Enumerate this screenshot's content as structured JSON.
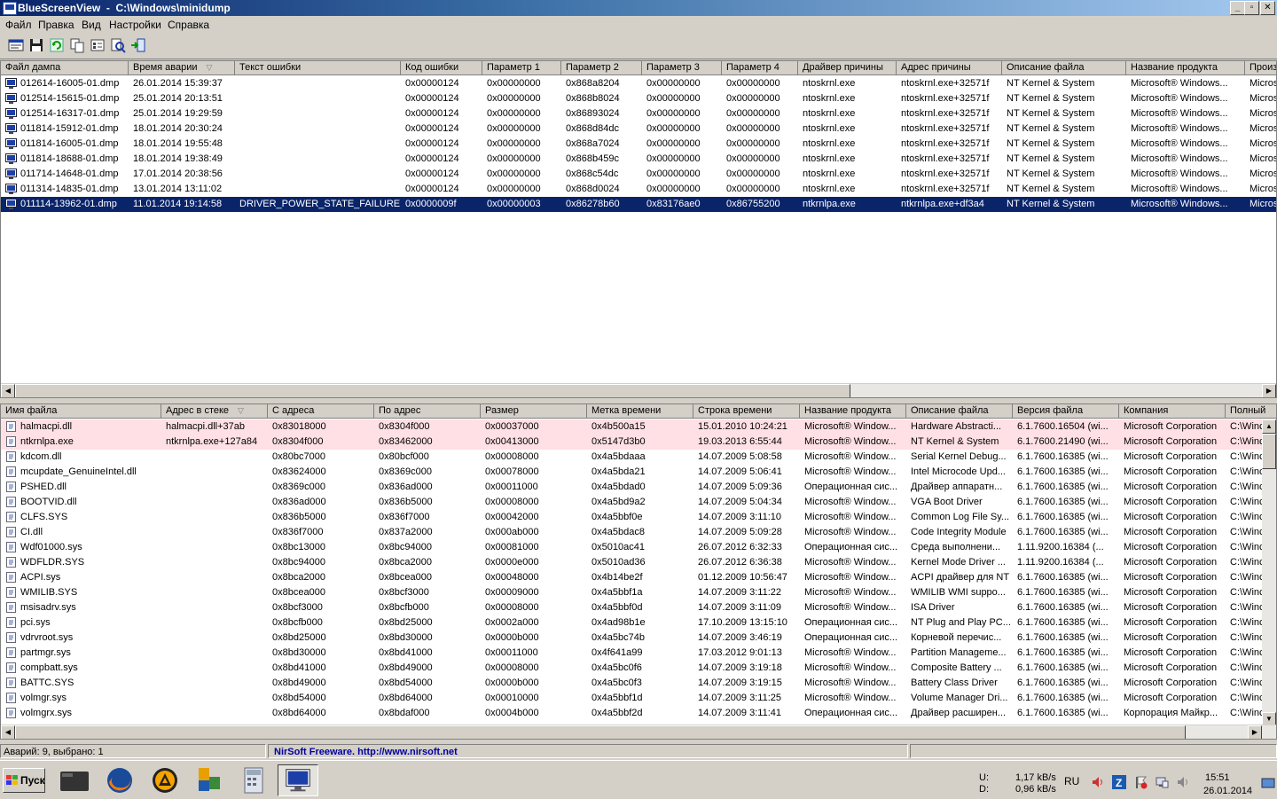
{
  "window": {
    "title": "BlueScreenView  -  C:\\Windows\\minidump"
  },
  "menu": [
    "Файл",
    "Правка",
    "Вид",
    "Настройки",
    "Справка"
  ],
  "toolbar_icons": [
    "properties-icon",
    "save-icon",
    "refresh-icon",
    "copy-icon",
    "options-icon",
    "find-icon",
    "exit-icon"
  ],
  "crashes": {
    "columns": [
      "Файл дампа",
      "Время аварии",
      "Текст ошибки",
      "Код ошибки",
      "Параметр 1",
      "Параметр 2",
      "Параметр 3",
      "Параметр 4",
      "Драйвер причины",
      "Адрес причины",
      "Описание файла",
      "Название продукта",
      "Произв"
    ],
    "sorted_column": 1,
    "rows": [
      [
        "012614-16005-01.dmp",
        "26.01.2014 15:39:37",
        "",
        "0x00000124",
        "0x00000000",
        "0x868a8204",
        "0x00000000",
        "0x00000000",
        "ntoskrnl.exe",
        "ntoskrnl.exe+32571f",
        "NT Kernel & System",
        "Microsoft® Windows...",
        "Micros"
      ],
      [
        "012514-15615-01.dmp",
        "25.01.2014 20:13:51",
        "",
        "0x00000124",
        "0x00000000",
        "0x868b8024",
        "0x00000000",
        "0x00000000",
        "ntoskrnl.exe",
        "ntoskrnl.exe+32571f",
        "NT Kernel & System",
        "Microsoft® Windows...",
        "Micros"
      ],
      [
        "012514-16317-01.dmp",
        "25.01.2014 19:29:59",
        "",
        "0x00000124",
        "0x00000000",
        "0x86893024",
        "0x00000000",
        "0x00000000",
        "ntoskrnl.exe",
        "ntoskrnl.exe+32571f",
        "NT Kernel & System",
        "Microsoft® Windows...",
        "Micros"
      ],
      [
        "011814-15912-01.dmp",
        "18.01.2014 20:30:24",
        "",
        "0x00000124",
        "0x00000000",
        "0x868d84dc",
        "0x00000000",
        "0x00000000",
        "ntoskrnl.exe",
        "ntoskrnl.exe+32571f",
        "NT Kernel & System",
        "Microsoft® Windows...",
        "Micros"
      ],
      [
        "011814-16005-01.dmp",
        "18.01.2014 19:55:48",
        "",
        "0x00000124",
        "0x00000000",
        "0x868a7024",
        "0x00000000",
        "0x00000000",
        "ntoskrnl.exe",
        "ntoskrnl.exe+32571f",
        "NT Kernel & System",
        "Microsoft® Windows...",
        "Micros"
      ],
      [
        "011814-18688-01.dmp",
        "18.01.2014 19:38:49",
        "",
        "0x00000124",
        "0x00000000",
        "0x868b459c",
        "0x00000000",
        "0x00000000",
        "ntoskrnl.exe",
        "ntoskrnl.exe+32571f",
        "NT Kernel & System",
        "Microsoft® Windows...",
        "Micros"
      ],
      [
        "011714-14648-01.dmp",
        "17.01.2014 20:38:56",
        "",
        "0x00000124",
        "0x00000000",
        "0x868c54dc",
        "0x00000000",
        "0x00000000",
        "ntoskrnl.exe",
        "ntoskrnl.exe+32571f",
        "NT Kernel & System",
        "Microsoft® Windows...",
        "Micros"
      ],
      [
        "011314-14835-01.dmp",
        "13.01.2014 13:11:02",
        "",
        "0x00000124",
        "0x00000000",
        "0x868d0024",
        "0x00000000",
        "0x00000000",
        "ntoskrnl.exe",
        "ntoskrnl.exe+32571f",
        "NT Kernel & System",
        "Microsoft® Windows...",
        "Micros"
      ],
      [
        "011114-13962-01.dmp",
        "11.01.2014 19:14:58",
        "DRIVER_POWER_STATE_FAILURE",
        "0x0000009f",
        "0x00000003",
        "0x86278b60",
        "0x83176ae0",
        "0x86755200",
        "ntkrnlpa.exe",
        "ntkrnlpa.exe+df3a4",
        "NT Kernel & System",
        "Microsoft® Windows...",
        "Micros"
      ]
    ],
    "selected_row": 8
  },
  "drivers": {
    "columns": [
      "Имя файла",
      "Адрес в стеке",
      "С адреса",
      "По адрес",
      "Размер",
      "Метка времени",
      "Строка времени",
      "Название продукта",
      "Описание файла",
      "Версия файла",
      "Компания",
      "Полный"
    ],
    "sorted_column": 1,
    "rows": [
      [
        "halmacpi.dll",
        "halmacpi.dll+37ab",
        "0x83018000",
        "0x8304f000",
        "0x00037000",
        "0x4b500a15",
        "15.01.2010 10:24:21",
        "Microsoft® Window...",
        "Hardware Abstracti...",
        "6.1.7600.16504 (wi...",
        "Microsoft Corporation",
        "C:\\Winc"
      ],
      [
        "ntkrnlpa.exe",
        "ntkrnlpa.exe+127a84",
        "0x8304f000",
        "0x83462000",
        "0x00413000",
        "0x5147d3b0",
        "19.03.2013 6:55:44",
        "Microsoft® Window...",
        "NT Kernel & System",
        "6.1.7600.21490 (wi...",
        "Microsoft Corporation",
        "C:\\Winc"
      ],
      [
        "kdcom.dll",
        "",
        "0x80bc7000",
        "0x80bcf000",
        "0x00008000",
        "0x4a5bdaaa",
        "14.07.2009 5:08:58",
        "Microsoft® Window...",
        "Serial Kernel Debug...",
        "6.1.7600.16385 (wi...",
        "Microsoft Corporation",
        "C:\\Winc"
      ],
      [
        "mcupdate_GenuineIntel.dll",
        "",
        "0x83624000",
        "0x8369c000",
        "0x00078000",
        "0x4a5bda21",
        "14.07.2009 5:06:41",
        "Microsoft® Window...",
        "Intel Microcode Upd...",
        "6.1.7600.16385 (wi...",
        "Microsoft Corporation",
        "C:\\Winc"
      ],
      [
        "PSHED.dll",
        "",
        "0x8369c000",
        "0x836ad000",
        "0x00011000",
        "0x4a5bdad0",
        "14.07.2009 5:09:36",
        "Операционная сис...",
        "Драйвер аппаратн...",
        "6.1.7600.16385 (wi...",
        "Microsoft Corporation",
        "C:\\Winc"
      ],
      [
        "BOOTVID.dll",
        "",
        "0x836ad000",
        "0x836b5000",
        "0x00008000",
        "0x4a5bd9a2",
        "14.07.2009 5:04:34",
        "Microsoft® Window...",
        "VGA Boot Driver",
        "6.1.7600.16385 (wi...",
        "Microsoft Corporation",
        "C:\\Winc"
      ],
      [
        "CLFS.SYS",
        "",
        "0x836b5000",
        "0x836f7000",
        "0x00042000",
        "0x4a5bbf0e",
        "14.07.2009 3:11:10",
        "Microsoft® Window...",
        "Common Log File Sy...",
        "6.1.7600.16385 (wi...",
        "Microsoft Corporation",
        "C:\\Winc"
      ],
      [
        "CI.dll",
        "",
        "0x836f7000",
        "0x837a2000",
        "0x000ab000",
        "0x4a5bdac8",
        "14.07.2009 5:09:28",
        "Microsoft® Window...",
        "Code Integrity Module",
        "6.1.7600.16385 (wi...",
        "Microsoft Corporation",
        "C:\\Winc"
      ],
      [
        "Wdf01000.sys",
        "",
        "0x8bc13000",
        "0x8bc94000",
        "0x00081000",
        "0x5010ac41",
        "26.07.2012 6:32:33",
        "Операционная сис...",
        "Среда выполнени...",
        "1.11.9200.16384 (...",
        "Microsoft Corporation",
        "C:\\Winc"
      ],
      [
        "WDFLDR.SYS",
        "",
        "0x8bc94000",
        "0x8bca2000",
        "0x0000e000",
        "0x5010ad36",
        "26.07.2012 6:36:38",
        "Microsoft® Window...",
        "Kernel Mode Driver ...",
        "1.11.9200.16384 (...",
        "Microsoft Corporation",
        "C:\\Winc"
      ],
      [
        "ACPI.sys",
        "",
        "0x8bca2000",
        "0x8bcea000",
        "0x00048000",
        "0x4b14be2f",
        "01.12.2009 10:56:47",
        "Microsoft® Window...",
        "ACPI драйвер для NT",
        "6.1.7600.16385 (wi...",
        "Microsoft Corporation",
        "C:\\Winc"
      ],
      [
        "WMILIB.SYS",
        "",
        "0x8bcea000",
        "0x8bcf3000",
        "0x00009000",
        "0x4a5bbf1a",
        "14.07.2009 3:11:22",
        "Microsoft® Window...",
        "WMILIB WMI suppo...",
        "6.1.7600.16385 (wi...",
        "Microsoft Corporation",
        "C:\\Winc"
      ],
      [
        "msisadrv.sys",
        "",
        "0x8bcf3000",
        "0x8bcfb000",
        "0x00008000",
        "0x4a5bbf0d",
        "14.07.2009 3:11:09",
        "Microsoft® Window...",
        "ISA Driver",
        "6.1.7600.16385 (wi...",
        "Microsoft Corporation",
        "C:\\Winc"
      ],
      [
        "pci.sys",
        "",
        "0x8bcfb000",
        "0x8bd25000",
        "0x0002a000",
        "0x4ad98b1e",
        "17.10.2009 13:15:10",
        "Операционная сис...",
        "NT Plug and Play PC...",
        "6.1.7600.16385 (wi...",
        "Microsoft Corporation",
        "C:\\Winc"
      ],
      [
        "vdrvroot.sys",
        "",
        "0x8bd25000",
        "0x8bd30000",
        "0x0000b000",
        "0x4a5bc74b",
        "14.07.2009 3:46:19",
        "Операционная сис...",
        "Корневой перечис...",
        "6.1.7600.16385 (wi...",
        "Microsoft Corporation",
        "C:\\Winc"
      ],
      [
        "partmgr.sys",
        "",
        "0x8bd30000",
        "0x8bd41000",
        "0x00011000",
        "0x4f641a99",
        "17.03.2012 9:01:13",
        "Microsoft® Window...",
        "Partition Manageme...",
        "6.1.7600.16385 (wi...",
        "Microsoft Corporation",
        "C:\\Winc"
      ],
      [
        "compbatt.sys",
        "",
        "0x8bd41000",
        "0x8bd49000",
        "0x00008000",
        "0x4a5bc0f6",
        "14.07.2009 3:19:18",
        "Microsoft® Window...",
        "Composite Battery ...",
        "6.1.7600.16385 (wi...",
        "Microsoft Corporation",
        "C:\\Winc"
      ],
      [
        "BATTC.SYS",
        "",
        "0x8bd49000",
        "0x8bd54000",
        "0x0000b000",
        "0x4a5bc0f3",
        "14.07.2009 3:19:15",
        "Microsoft® Window...",
        "Battery Class Driver",
        "6.1.7600.16385 (wi...",
        "Microsoft Corporation",
        "C:\\Winc"
      ],
      [
        "volmgr.sys",
        "",
        "0x8bd54000",
        "0x8bd64000",
        "0x00010000",
        "0x4a5bbf1d",
        "14.07.2009 3:11:25",
        "Microsoft® Window...",
        "Volume Manager Dri...",
        "6.1.7600.16385 (wi...",
        "Microsoft Corporation",
        "C:\\Winc"
      ],
      [
        "volmgrx.sys",
        "",
        "0x8bd64000",
        "0x8bdaf000",
        "0x0004b000",
        "0x4a5bbf2d",
        "14.07.2009 3:11:41",
        "Операционная сис...",
        "Драйвер расширен...",
        "6.1.7600.16385 (wi...",
        "Корпорация Майкр...",
        "C:\\Winc"
      ]
    ],
    "highlighted_rows": [
      0,
      1
    ]
  },
  "status": {
    "count_text": "Аварий: 9, выбрано: 1",
    "credit_text": "NirSoft Freeware.  http://www.nirsoft.net"
  },
  "taskbar": {
    "start_label": "Пуск",
    "apps": [
      "file-manager-icon",
      "firefox-icon",
      "aimp-icon",
      "office-icon",
      "calculator-icon",
      "bluescreenview-icon"
    ],
    "active_app": 5,
    "net_up_label": "U:",
    "net_down_label": "D:",
    "net_up": "1,17 kB/s",
    "net_down": "0,96 kB/s",
    "lang": "RU",
    "time": "15:51",
    "date": "26.01.2014"
  },
  "colors": {
    "selection": "#0a246a",
    "highlight": "#ffe0e4",
    "link": "#0000a0"
  }
}
